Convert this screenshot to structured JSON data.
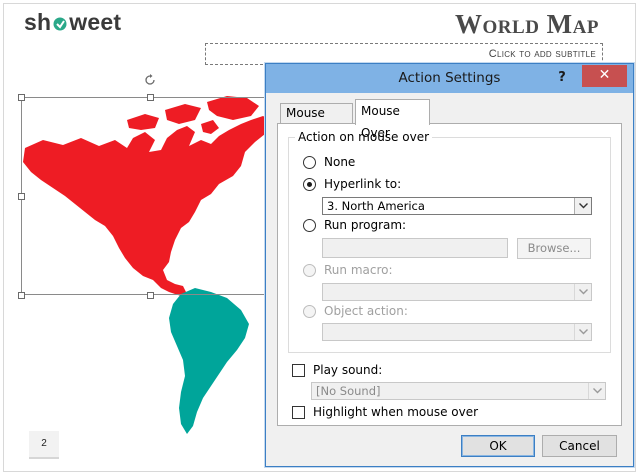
{
  "slide": {
    "logo": {
      "prefix": "sh",
      "suffix": "weet"
    },
    "title": "World Map",
    "subtitle_placeholder": "Click to add subtitle",
    "page_number": "2",
    "colors": {
      "north_america": "#ee1c24",
      "south_america": "#00a59a"
    }
  },
  "dialog": {
    "title": "Action Settings",
    "help_label": "?",
    "close_label": "✕",
    "tabs": [
      {
        "label": "Mouse Click",
        "active": false
      },
      {
        "label": "Mouse Over",
        "active": true
      }
    ],
    "group_label": "Action on mouse over",
    "options": {
      "none": {
        "label": "None",
        "checked": false
      },
      "hyperlink": {
        "label": "Hyperlink to:",
        "checked": true,
        "value": "3. North America"
      },
      "run_program": {
        "label": "Run program:",
        "value": "",
        "browse_label": "Browse..."
      },
      "run_macro": {
        "label": "Run macro:",
        "value": ""
      },
      "object_action": {
        "label": "Object action:",
        "value": ""
      }
    },
    "play_sound": {
      "label": "Play sound:",
      "checked": false,
      "value": "[No Sound]"
    },
    "highlight": {
      "label": "Highlight when mouse over",
      "checked": false
    },
    "ok_label": "OK",
    "cancel_label": "Cancel"
  }
}
